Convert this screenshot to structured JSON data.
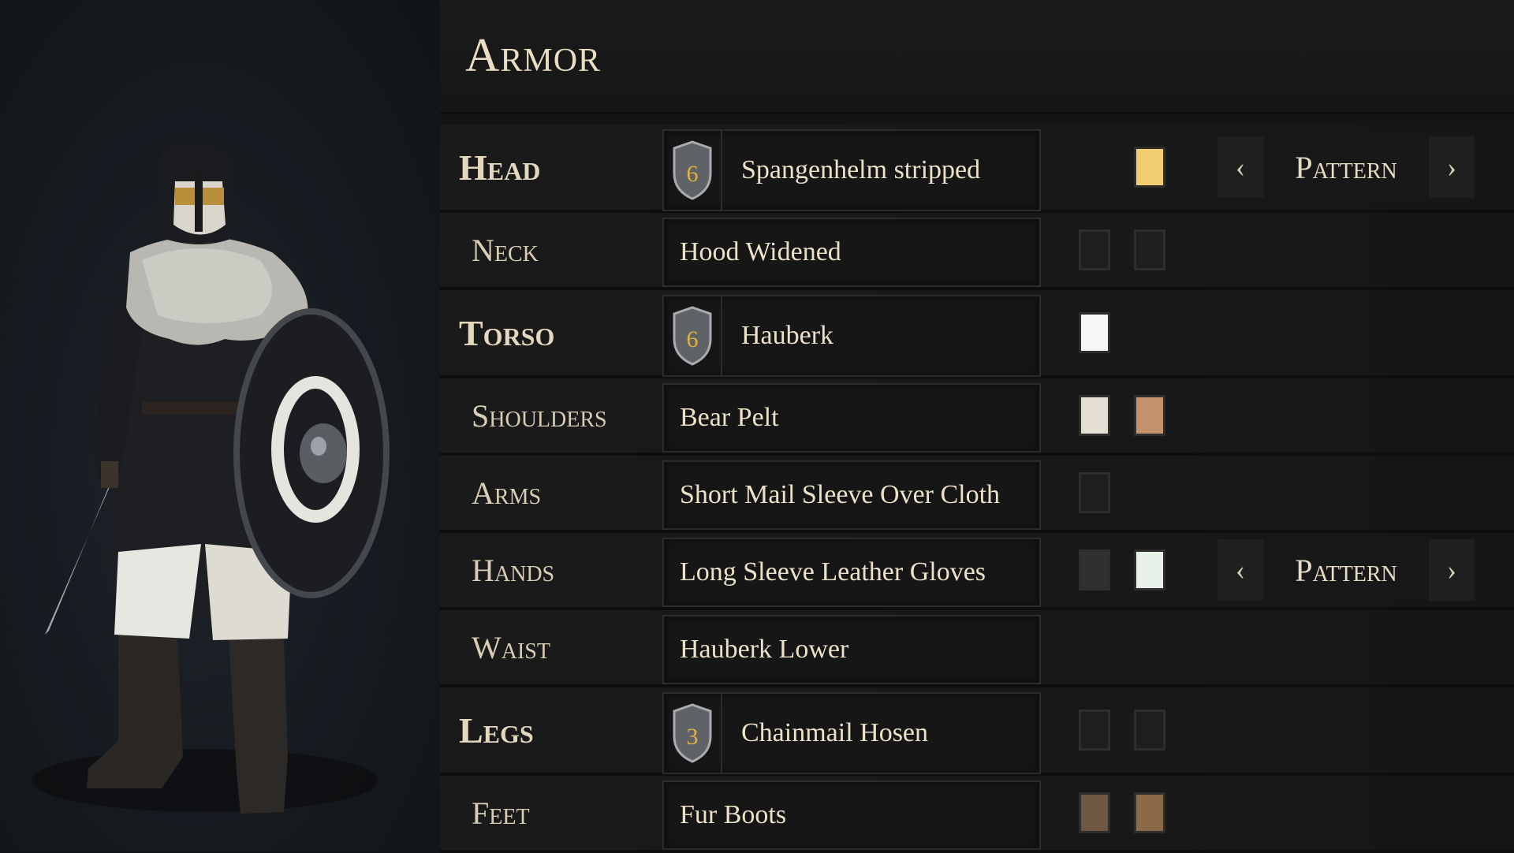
{
  "panel_title": "Armor",
  "colors": {
    "accent_text": "#e9dec3",
    "tier_number": "#e2b23a"
  },
  "slots": [
    {
      "label": "Head",
      "item": "Spangenhelm stripped",
      "tier": "6",
      "swatches": [
        "#f3cd72"
      ],
      "pattern": {
        "label": "Pattern",
        "prev_icon": "chevron-left-icon",
        "next_icon": "chevron-right-icon"
      }
    },
    {
      "label": "Neck",
      "item": "Hood Widened",
      "swatches": [
        "#1f1f1f",
        "#1f1f1f"
      ]
    },
    {
      "label": "Torso",
      "item": "Hauberk",
      "tier": "6",
      "swatches": [
        "#f7f7f7"
      ]
    },
    {
      "label": "Shoulders",
      "item": "Bear Pelt",
      "swatches": [
        "#e4ded3",
        "#c4926a"
      ]
    },
    {
      "label": "Arms",
      "item": "Short Mail Sleeve Over Cloth",
      "swatches": [
        "#1e1e1e"
      ]
    },
    {
      "label": "Hands",
      "item": "Long Sleeve Leather Gloves",
      "swatches": [
        "#303030",
        "#e8f2e8"
      ],
      "pattern": {
        "label": "Pattern",
        "prev_icon": "chevron-left-icon",
        "next_icon": "chevron-right-icon"
      }
    },
    {
      "label": "Waist",
      "item": "Hauberk Lower",
      "swatches": []
    },
    {
      "label": "Legs",
      "item": "Chainmail Hosen",
      "tier": "3",
      "swatches": [
        "#1e1e1e",
        "#1e1e1e"
      ]
    },
    {
      "label": "Feet",
      "item": "Fur Boots",
      "swatches": [
        "#6e5843",
        "#8a6a47"
      ]
    }
  ]
}
